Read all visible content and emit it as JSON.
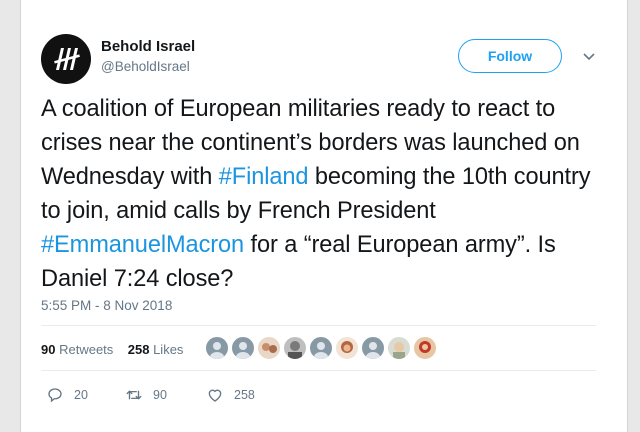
{
  "author": {
    "name": "Behold Israel",
    "handle": "@BeholdIsrael"
  },
  "follow_label": "Follow",
  "tweet": {
    "t1": "A coalition of European militaries ready to react to crises near the continent’s borders was launched on Wednesday with ",
    "tag1": "#Finland",
    "t2": " becoming the 10th country to join, amid calls by French President ",
    "tag2": "#EmmanuelMacron",
    "t3": " for a “real European army”. Is Daniel 7:24 close?"
  },
  "timestamp": "5:55 PM - 8 Nov 2018",
  "stats": {
    "retweets_count": "90",
    "retweets_label": "Retweets",
    "likes_count": "258",
    "likes_label": "Likes"
  },
  "actions": {
    "reply_count": "20",
    "retweet_count": "90",
    "like_count": "258"
  },
  "colors": {
    "link": "#1b95e0",
    "text": "#14171a",
    "muted": "#657786"
  }
}
